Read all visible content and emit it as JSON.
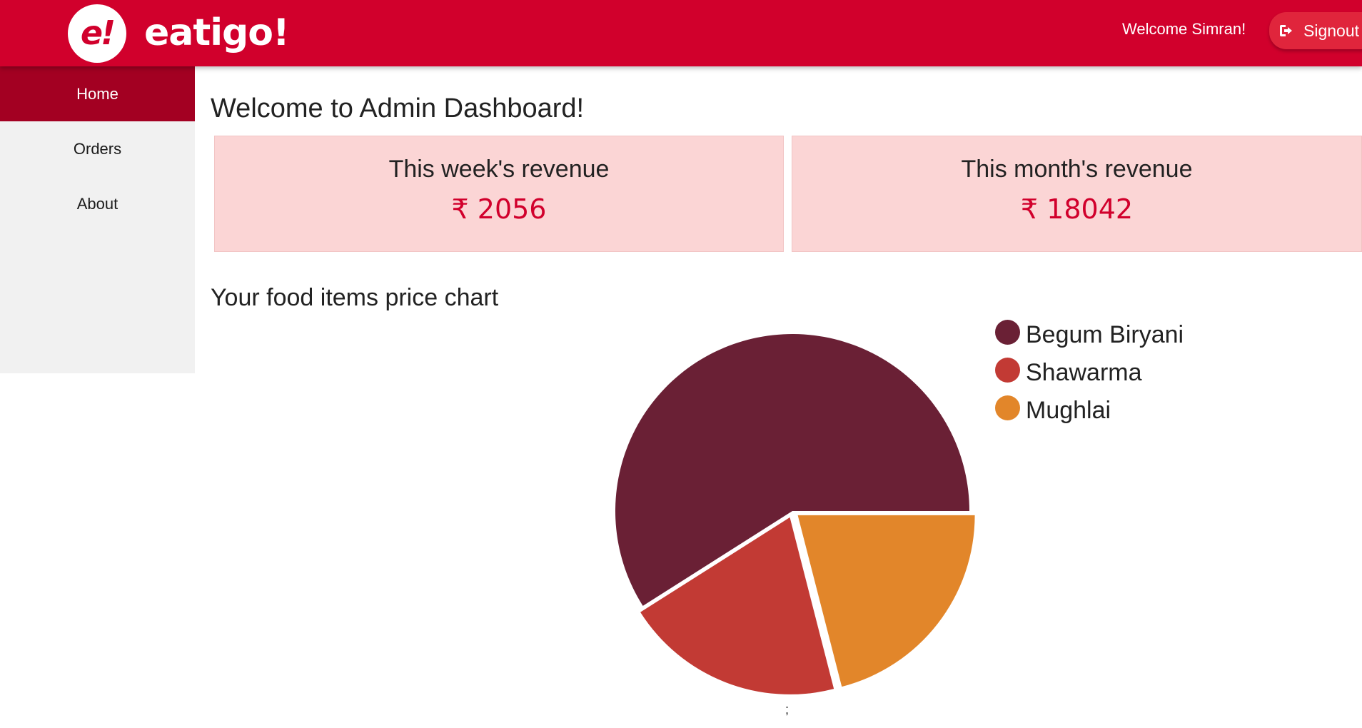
{
  "header": {
    "logo_badge": "e!",
    "logo_text": "eatigo!",
    "welcome": "Welcome Simran!",
    "signout_label": "Signout",
    "signout_icon": "sign-out-icon",
    "brand_color": "#d1002c"
  },
  "sidebar": {
    "items": [
      {
        "label": "Home",
        "active": true
      },
      {
        "label": "Orders",
        "active": false
      },
      {
        "label": "About",
        "active": false
      }
    ],
    "active_color": "#a30022"
  },
  "main": {
    "title": "Welcome to Admin Dashboard!",
    "cards": [
      {
        "label": "This week's revenue",
        "value": "₹ 2056"
      },
      {
        "label": "This month's revenue",
        "value": "₹ 18042"
      }
    ],
    "chart_title": "Your food items price chart",
    "stray_mark": ";"
  },
  "chart_data": {
    "type": "pie",
    "title": "Your food items price chart",
    "legend_position": "right",
    "series": [
      {
        "name": "Begum Biryani",
        "value": 59,
        "color": "#6a2035"
      },
      {
        "name": "Shawarma",
        "value": 20,
        "color": "#c23a34"
      },
      {
        "name": "Mughlai",
        "value": 21,
        "color": "#e2862a"
      }
    ]
  }
}
